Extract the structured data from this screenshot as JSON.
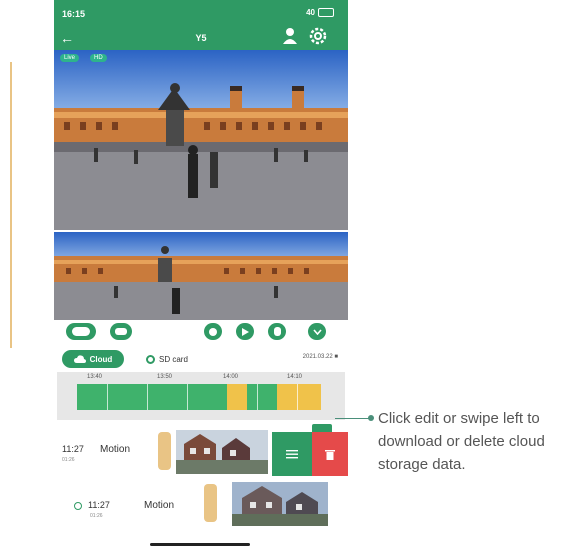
{
  "status": {
    "time": "16:15",
    "signal": "40"
  },
  "header": {
    "title": "Y5"
  },
  "video": {
    "badge_live": "Live",
    "badge_quality": "HD"
  },
  "tabs": {
    "cloud_label": "Cloud",
    "sd_label": "SD card",
    "date": "2021.03.22"
  },
  "timeline": {
    "labels": [
      "13:40",
      "13:50",
      "14:00",
      "14:10"
    ]
  },
  "events": [
    {
      "time": "11:27",
      "sub": "01:26",
      "type": "Motion"
    },
    {
      "time": "11:27",
      "sub": "01:26",
      "type": "Motion"
    }
  ],
  "callout": {
    "text": "Click edit or swipe left to download or delete cloud storage data."
  },
  "colors": {
    "brand": "#2f9a64",
    "delete": "#e54a4a",
    "motion_yellow": "#f0c24a",
    "timeline_green": "#3fb26c"
  },
  "icons": [
    "back-arrow-icon",
    "person-icon",
    "gear-icon",
    "record-icon",
    "message-icon",
    "replay-icon",
    "play-icon",
    "audio-icon",
    "chevron-down-icon",
    "cloud-icon",
    "calendar-icon",
    "download-icon",
    "trash-icon"
  ]
}
